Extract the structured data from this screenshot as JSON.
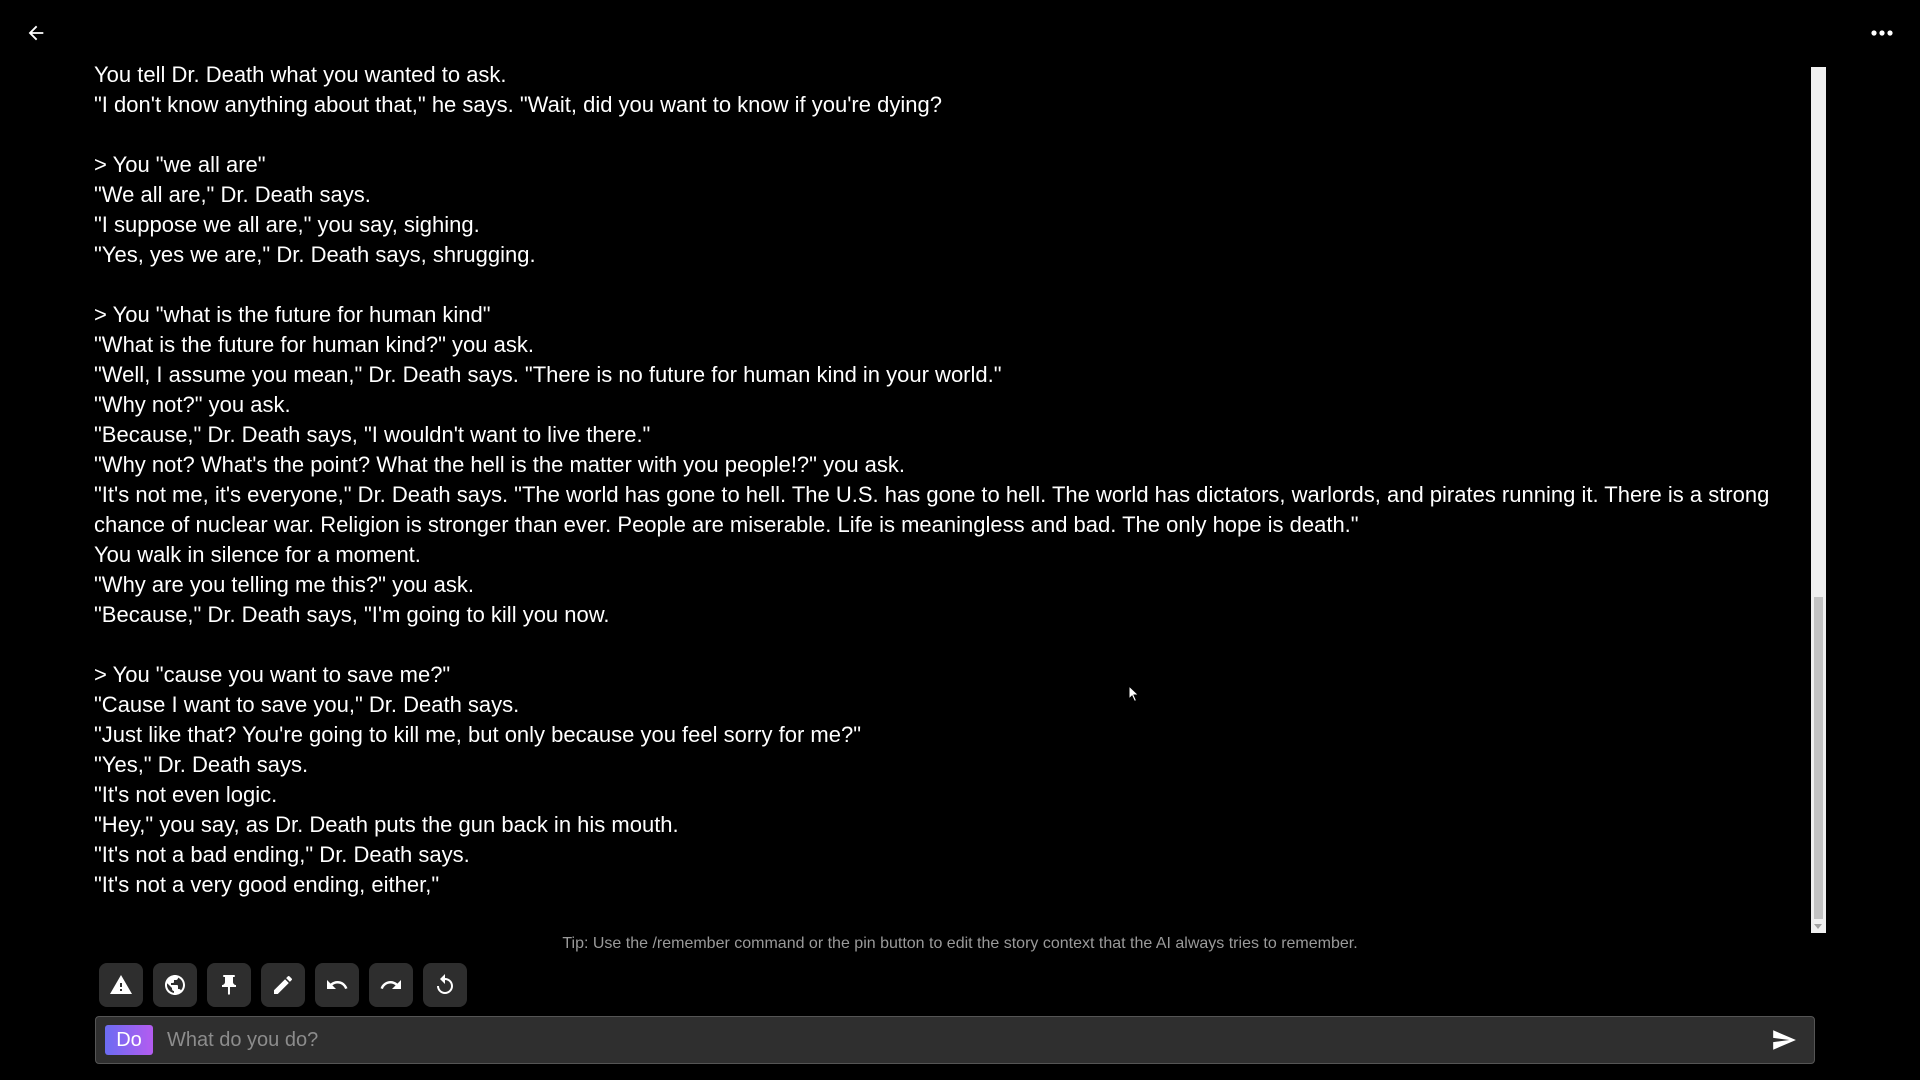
{
  "story": {
    "lines": [
      "You tell Dr. Death what you wanted to ask.",
      "\"I don't know anything about that,\" he says. \"Wait, did you want to know if you're dying?",
      "",
      "> You \"we all are\"",
      "\"We all are,\" Dr. Death says.",
      "\"I suppose we all are,\" you say, sighing.",
      "\"Yes, yes we are,\" Dr. Death says, shrugging.",
      "",
      "> You \"what is the future for human kind\"",
      "\"What is the future for human kind?\" you ask.",
      "\"Well, I assume you mean,\" Dr. Death says. \"There is no future for human kind in your world.\"",
      "\"Why not?\" you ask.",
      "\"Because,\" Dr. Death says, \"I wouldn't want to live there.\"",
      "\"Why not? What's the point? What the hell is the matter with you people!?\" you ask.",
      "\"It's not me, it's everyone,\" Dr. Death says. \"The world has gone to hell. The U.S. has gone to hell. The world has dictators, warlords, and pirates running it. There is a strong chance of nuclear war. Religion is stronger than ever. People are miserable. Life is meaningless and bad. The only hope is death.\"",
      "You walk in silence for a moment.",
      "\"Why are you telling me this?\" you ask.",
      "\"Because,\" Dr. Death says, \"I'm going to kill you now.",
      "",
      "> You \"cause you want to save me?\"",
      "\"Cause I want to save you,\" Dr. Death says.",
      "\"Just like that? You're going to kill me, but only because you feel sorry for me?\"",
      "\"Yes,\" Dr. Death says.",
      "\"It's not even logic.",
      "\"Hey,\" you say, as Dr. Death puts the gun back in his mouth.",
      "\"It's not a bad ending,\" Dr. Death says.",
      "\"It's not a very good ending, either,\""
    ]
  },
  "tip": "Tip: Use the /remember command or the pin button to edit the story context that the AI always tries to remember.",
  "toolbar": {
    "buttons": [
      {
        "icon": "warning-icon"
      },
      {
        "icon": "globe-icon"
      },
      {
        "icon": "pin-icon"
      },
      {
        "icon": "pencil-icon"
      },
      {
        "icon": "undo-icon"
      },
      {
        "icon": "redo-icon"
      },
      {
        "icon": "retry-icon"
      }
    ]
  },
  "input": {
    "mode_label": "Do",
    "placeholder": "What do you do?",
    "value": ""
  },
  "header": {
    "back_icon": "arrow-left-icon",
    "menu_icon": "more-horizontal-icon"
  },
  "colors": {
    "background": "#000000",
    "text": "#ffffff",
    "tip": "#9a9a9a",
    "toolbar_button": "#2e2e2e",
    "input_background": "#2f2f2f",
    "mode_gradient_start": "#6b6cf2",
    "mode_gradient_end": "#b45cf0"
  }
}
